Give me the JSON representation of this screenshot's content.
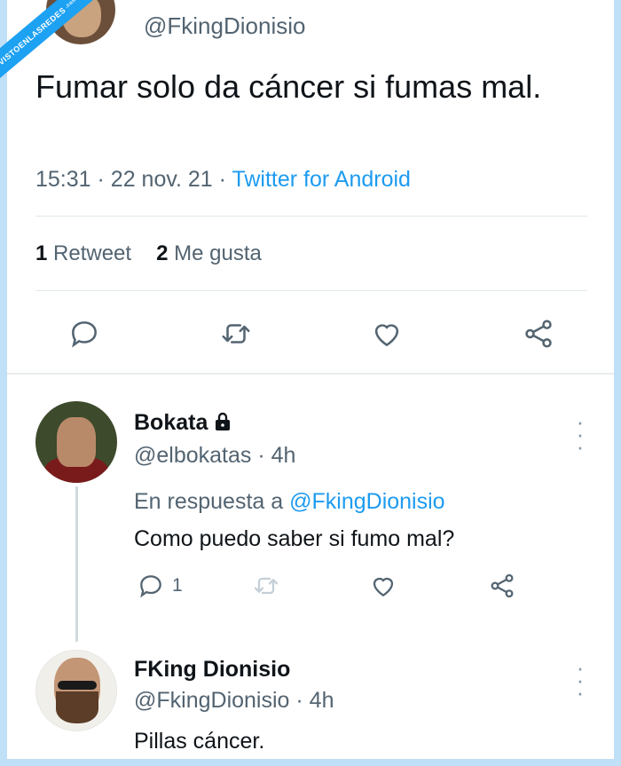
{
  "watermark": {
    "text": "VISTOENLASREDES",
    "sub": ".com"
  },
  "tweet": {
    "handle": "@FkingDionisio",
    "text": "Fumar solo da cáncer si fumas mal.",
    "time": "15:31",
    "date": "22 nov. 21",
    "source": "Twitter for Android",
    "retweets_count": "1",
    "retweets_label": "Retweet",
    "likes_count": "2",
    "likes_label": "Me gusta",
    "actions": [
      "reply-icon",
      "retweet-icon",
      "like-icon",
      "share-icon"
    ]
  },
  "replies": [
    {
      "name": "Bokata",
      "locked": true,
      "handle": "@elbokatas",
      "time": "4h",
      "in_reply_to_label": "En respuesta a",
      "in_reply_to": "@FkingDionisio",
      "text": "Como puedo saber si fumo mal?",
      "reply_count": "1"
    },
    {
      "name": "FKing Dionisio",
      "handle": "@FkingDionisio",
      "time": "4h",
      "text": "Pillas cáncer."
    }
  ],
  "colors": {
    "accent": "#1d9bf0",
    "muted": "#536471",
    "text": "#0f1419",
    "border": "#bfe0f7"
  }
}
